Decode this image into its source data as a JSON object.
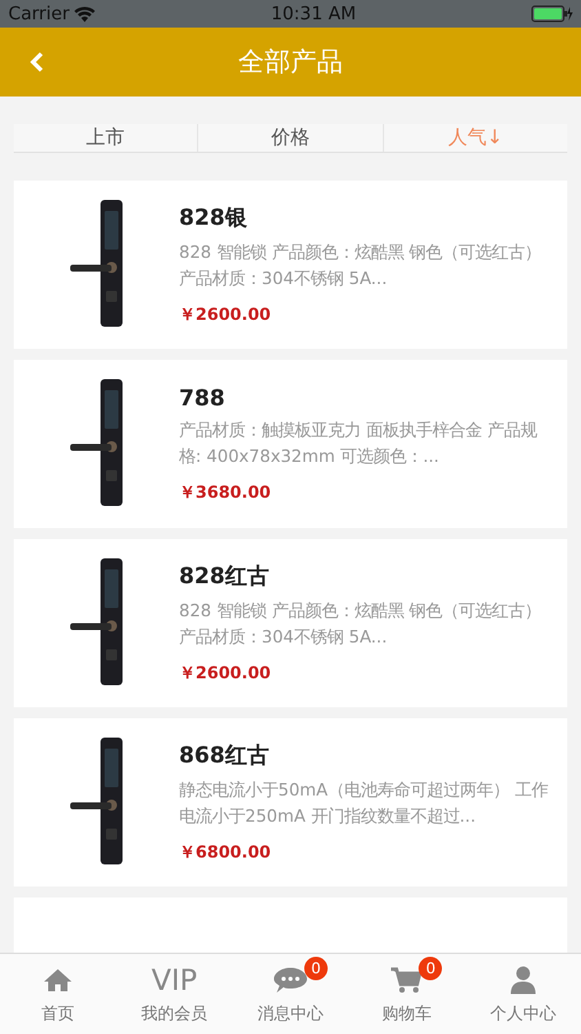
{
  "status_bar": {
    "carrier": "Carrier",
    "time": "10:31 AM"
  },
  "header": {
    "title": "全部产品"
  },
  "sort_tabs": [
    {
      "label": "上市",
      "selected": false
    },
    {
      "label": "价格",
      "selected": false
    },
    {
      "label": "人气↓",
      "selected": true
    }
  ],
  "products": [
    {
      "name": "828银",
      "description": "828 智能锁 产品颜色：炫酷黑 钢色（可选红古）产品材质：304不锈钢 5A...",
      "price": "￥2600.00"
    },
    {
      "name": "788",
      "description": "产品材质：触摸板亚克力 面板执手梓合金 产品规格: 400x78x32mm 可选颜色：...",
      "price": "￥3680.00"
    },
    {
      "name": "828红古",
      "description": "828 智能锁 产品颜色：炫酷黑 钢色（可选红古）产品材质：304不锈钢 5A...",
      "price": "￥2600.00"
    },
    {
      "name": "868红古",
      "description": "静态电流小于50mA（电池寿命可超过两年） 工作电流小于250mA 开门指纹数量不超过...",
      "price": "￥6800.00"
    }
  ],
  "tab_bar": [
    {
      "kind": "home",
      "label": "首页"
    },
    {
      "kind": "vip",
      "icon_text": "VIP",
      "label": "我的会员"
    },
    {
      "kind": "message",
      "badge": "0",
      "label": "消息中心"
    },
    {
      "kind": "cart",
      "badge": "0",
      "label": "购物车"
    },
    {
      "kind": "person",
      "label": "个人中心"
    }
  ]
}
